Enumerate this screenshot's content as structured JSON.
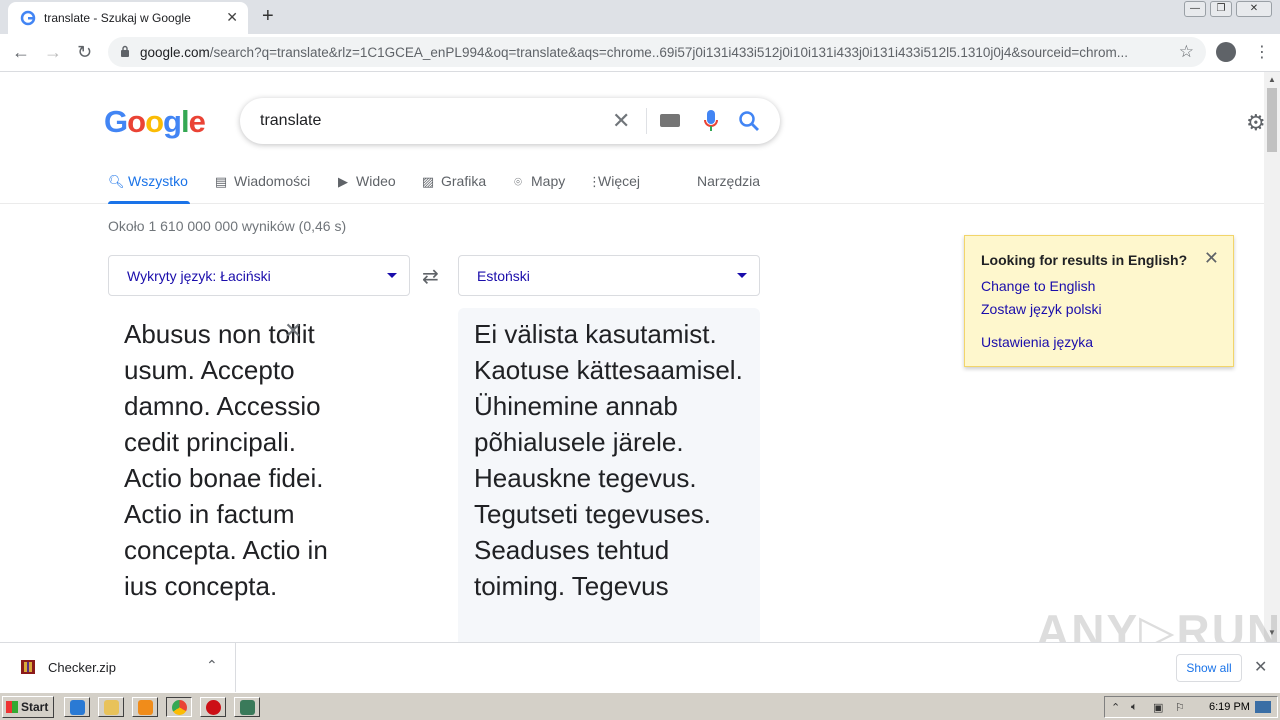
{
  "browser": {
    "tab_title": "translate - Szukaj w Google",
    "url_host": "google.com",
    "url_rest": "/search?q=translate&rlz=1C1GCEA_enPL994&oq=translate&aqs=chrome..69i57j0i131i433i512j0i10i131i433j0i131i433i512l5.1310j0j4&sourceid=chrom..."
  },
  "google": {
    "logo": "Google",
    "query": "translate",
    "tabs": [
      {
        "label": "Wszystko",
        "icon": "search-icon"
      },
      {
        "label": "Wiadomości",
        "icon": "news-icon"
      },
      {
        "label": "Wideo",
        "icon": "video-icon"
      },
      {
        "label": "Grafika",
        "icon": "image-icon"
      },
      {
        "label": "Mapy",
        "icon": "map-pin-icon"
      },
      {
        "label": "Więcej",
        "icon": "more-vert-icon"
      }
    ],
    "tools": "Narzędzia",
    "stats": "Około 1 610 000 000 wyników (0,46 s)"
  },
  "translate": {
    "source_lang": "Wykryty język: Łaciński",
    "target_lang": "Estoński",
    "source_text": "Abusus non tollit usum. Accepto damno. Accessio cedit principali. Actio bonae fidei. Actio in factum concepta. Actio in ius concepta.",
    "target_text": "Ei välista kasutamist. Kaotuse kättesaamisel. Ühinemine annab põhialusele järele. Heauskne tegevus. Tegutseti tegevuses. Seaduses tehtud toiming. Tegevus"
  },
  "lang_popup": {
    "heading": "Looking for results in English?",
    "change": "Change to English",
    "keep": "Zostaw język polski",
    "settings": "Ustawienia języka"
  },
  "downloads": {
    "file": "Checker.zip",
    "show_all": "Show all"
  },
  "watermark": "ANY▷RUN",
  "taskbar": {
    "start": "Start",
    "clock": "6:19 PM"
  },
  "colors": {
    "link": "#1a0dab",
    "accent": "#1a73e8",
    "popup_bg": "#fef7cd"
  }
}
